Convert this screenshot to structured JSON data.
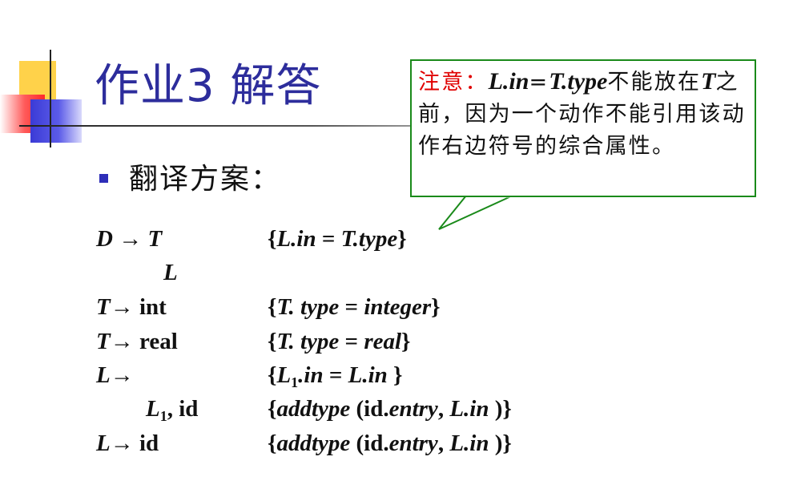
{
  "slide": {
    "title": "作业3 解答",
    "bullet": "翻译方案：",
    "callout": {
      "label": "注意：",
      "text": "L.in=T.type不能放在T之前，因为一个动作不能引用该动作右边符号的综合属性。"
    },
    "grammar": [
      {
        "production": "D → T L",
        "action": "{L.in = T.type}"
      },
      {
        "production": "T→ int",
        "action": "{T. type = integer}"
      },
      {
        "production": "T→ real",
        "action": "{T. type = real}"
      },
      {
        "production": "L→ L1, id",
        "action": "{L1.in = L.in } {addtype (id.entry, L.in )}"
      },
      {
        "production": "L→ id",
        "action": "{addtype (id.entry, L.in )}"
      }
    ]
  }
}
